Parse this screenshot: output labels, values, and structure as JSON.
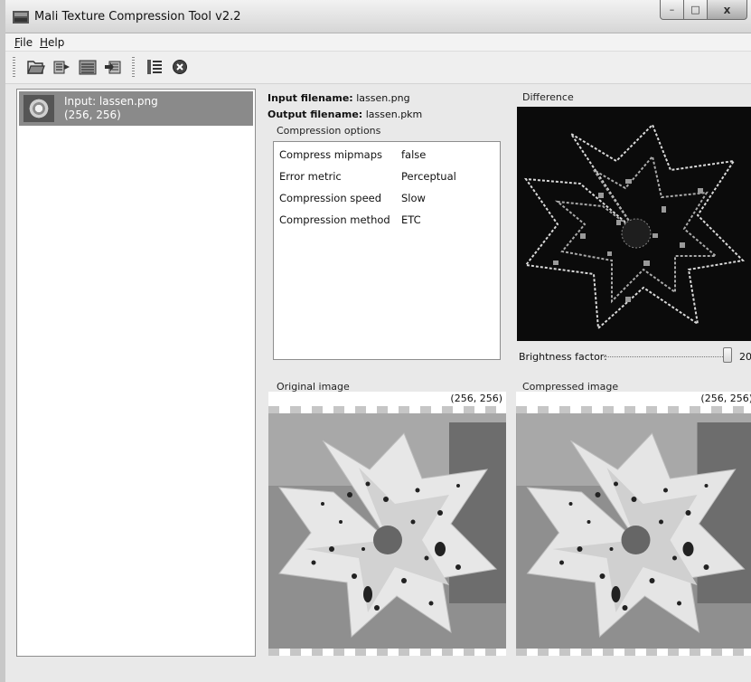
{
  "window": {
    "title": "Mali Texture Compression Tool v2.2",
    "min_glyph": "–",
    "max_glyph": "□",
    "close_glyph": "x"
  },
  "menu": {
    "file_key": "F",
    "file_rest": "ile",
    "help_key": "H",
    "help_rest": "elp"
  },
  "toolbar": {
    "icons": [
      "open-file-icon",
      "compress-icon",
      "compress-all-icon",
      "decompress-icon",
      "list-settings-icon",
      "remove-icon"
    ]
  },
  "file_list": {
    "items": [
      {
        "name": "Input: lassen.png",
        "size": "(256, 256)"
      }
    ]
  },
  "info": {
    "input_label": "Input filename:",
    "input_value": "lassen.png",
    "output_label": "Output filename:",
    "output_value": "lassen.pkm"
  },
  "compression_options": {
    "title": "Compression options",
    "rows": [
      {
        "name": "Compress mipmaps",
        "value": "false"
      },
      {
        "name": "Error metric",
        "value": "Perceptual"
      },
      {
        "name": "Compression speed",
        "value": "Slow"
      },
      {
        "name": "Compression method",
        "value": "ETC"
      }
    ]
  },
  "difference": {
    "title": "Difference",
    "brightness_label": "Brightness factor:",
    "brightness_value": "20",
    "brightness_fraction": 0.95
  },
  "original": {
    "title": "Original image",
    "size": "(256, 256)"
  },
  "compressed": {
    "title": "Compressed image",
    "size": "(256, 256)"
  },
  "colors": {
    "selection": "#8a8a8a",
    "window_bg": "#e9e9e9"
  }
}
